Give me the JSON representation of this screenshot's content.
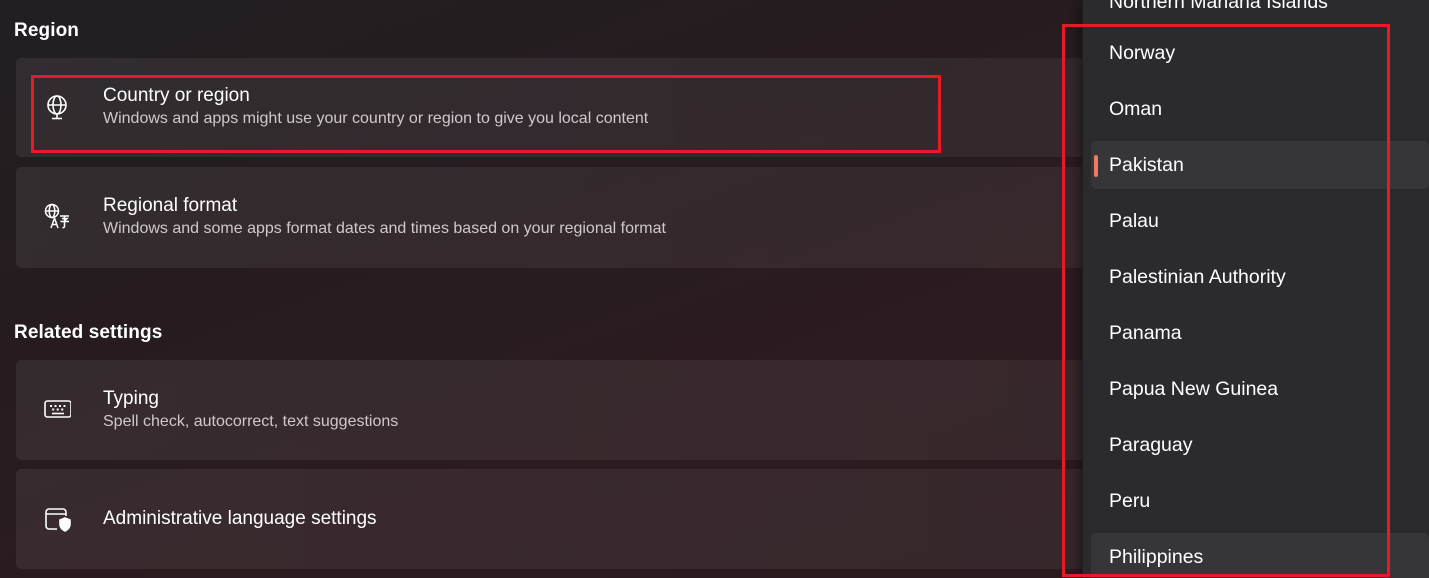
{
  "region": {
    "heading": "Region",
    "items": [
      {
        "icon": "globe-icon",
        "title": "Country or region",
        "subtitle": "Windows and apps might use your country or region to give you local content"
      },
      {
        "icon": "language-format-icon",
        "title": "Regional format",
        "subtitle": "Windows and some apps format dates and times based on your regional format"
      }
    ]
  },
  "related": {
    "heading": "Related settings",
    "items": [
      {
        "icon": "keyboard-icon",
        "title": "Typing",
        "subtitle": "Spell check, autocorrect, text suggestions"
      },
      {
        "icon": "admin-shield-icon",
        "title": "Administrative language settings"
      }
    ]
  },
  "country_dropdown": {
    "selected": "Pakistan",
    "accent_color": "#ef7a5f",
    "options": [
      "Northern Mariana Islands",
      "Norway",
      "Oman",
      "Pakistan",
      "Palau",
      "Palestinian Authority",
      "Panama",
      "Papua New Guinea",
      "Paraguay",
      "Peru",
      "Philippines"
    ]
  },
  "annotation": {
    "highlight_color": "#e81a24"
  }
}
